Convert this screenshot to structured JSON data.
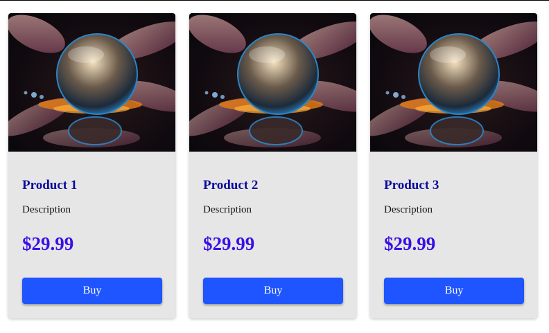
{
  "products": [
    {
      "title": "Product 1",
      "description": "Description",
      "price": "$29.99",
      "button": "Buy",
      "image": "droplet-on-flower-photo"
    },
    {
      "title": "Product 2",
      "description": "Description",
      "price": "$29.99",
      "button": "Buy",
      "image": "droplet-on-flower-photo"
    },
    {
      "title": "Product 3",
      "description": "Description",
      "price": "$29.99",
      "button": "Buy",
      "image": "droplet-on-flower-photo"
    }
  ],
  "colors": {
    "card_background": "#e6e6e6",
    "title": "#0b0b9c",
    "price": "#3a0fe6",
    "button": "#1f55ff"
  }
}
